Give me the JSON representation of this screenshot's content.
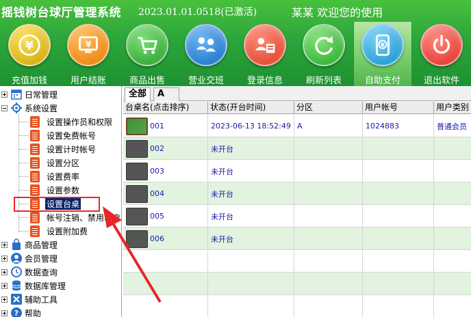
{
  "header": {
    "app_title": "摇钱树台球厅管理系统",
    "version": "2023.01.01.0518(已激活)",
    "welcome": "某某 欢迎您的使用"
  },
  "toolbar": [
    {
      "label": "充值加钱",
      "icon": "yen-coin-icon",
      "color": "#d8b418"
    },
    {
      "label": "用户结账",
      "icon": "monitor-yen-icon",
      "color": "#f08a18"
    },
    {
      "label": "商品出售",
      "icon": "shopping-cart-icon",
      "color": "#3cae3c"
    },
    {
      "label": "营业交班",
      "icon": "user-swap-icon",
      "color": "#2a7fd0"
    },
    {
      "label": "登录信息",
      "icon": "user-card-icon",
      "color": "#e45038"
    },
    {
      "label": "刷新列表",
      "icon": "refresh-icon",
      "color": "#3cb83c"
    },
    {
      "label": "自助支付",
      "icon": "phone-yen-icon",
      "color": "#2aa0d8"
    },
    {
      "label": "退出软件",
      "icon": "power-icon",
      "color": "#e8423a"
    }
  ],
  "tree": {
    "daily": "日常管理",
    "settings": "系统设置",
    "settings_items": [
      "设置操作员和权限",
      "设置免费帐号",
      "设置计时帐号",
      "设置分区",
      "设置费率",
      "设置参数",
      "设置台桌",
      "帐号注销、禁用、启用",
      "设置附加费"
    ],
    "goods": "商品管理",
    "members": "会员管理",
    "query": "数据查询",
    "database": "数据库管理",
    "tools": "辅助工具",
    "help": "帮助"
  },
  "tabs": [
    "全部",
    "A"
  ],
  "grid": {
    "columns": [
      "台桌名(点击排序)",
      "状态(开台时间)",
      "分区",
      "用户帐号",
      "用户类别"
    ],
    "rows": [
      {
        "name": "001",
        "status": "2023-06-13 18:52:49",
        "zone": "A",
        "account": "1024883",
        "type": "普通会员"
      },
      {
        "name": "002",
        "status": "未开台",
        "zone": "",
        "account": "",
        "type": ""
      },
      {
        "name": "003",
        "status": "未开台",
        "zone": "",
        "account": "",
        "type": ""
      },
      {
        "name": "004",
        "status": "未开台",
        "zone": "",
        "account": "",
        "type": ""
      },
      {
        "name": "005",
        "status": "未开台",
        "zone": "",
        "account": "",
        "type": ""
      },
      {
        "name": "006",
        "status": "未开台",
        "zone": "",
        "account": "",
        "type": ""
      },
      {
        "name": "",
        "status": "",
        "zone": "",
        "account": "",
        "type": ""
      },
      {
        "name": "",
        "status": "",
        "zone": "",
        "account": "",
        "type": ""
      },
      {
        "name": "",
        "status": "",
        "zone": "",
        "account": "",
        "type": ""
      }
    ]
  },
  "colors": {
    "header_green": "#2ca63c",
    "highlight_red": "#e8262b",
    "row_alt": "#e2f3df",
    "text_blue": "#1a1aa8"
  }
}
